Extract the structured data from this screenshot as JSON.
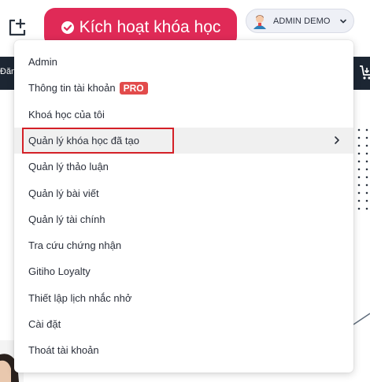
{
  "header": {
    "activate_label": "Kích hoạt khóa học",
    "user_name": "ADMIN DEMO"
  },
  "nav": {
    "left_partial_text": "Đăng"
  },
  "menu": {
    "items": [
      {
        "label": "Admin"
      },
      {
        "label": "Thông tin tài khoản",
        "badge": "PRO"
      },
      {
        "label": "Khoá học của tôi"
      },
      {
        "label": "Quản lý khóa học đã tạo"
      },
      {
        "label": "Quản lý thảo luận"
      },
      {
        "label": "Quản lý bài viết"
      },
      {
        "label": "Quản lý tài chính"
      },
      {
        "label": "Tra cứu chứng nhận"
      },
      {
        "label": "Gitiho Loyalty"
      },
      {
        "label": "Thiết lập lịch nhắc nhở"
      },
      {
        "label": "Cài đặt"
      },
      {
        "label": "Thoát tài khoản"
      }
    ]
  },
  "colors": {
    "accent": "#e02a57",
    "nav": "#1c2633",
    "highlight": "#d42027",
    "badge": "#e24b4b"
  }
}
